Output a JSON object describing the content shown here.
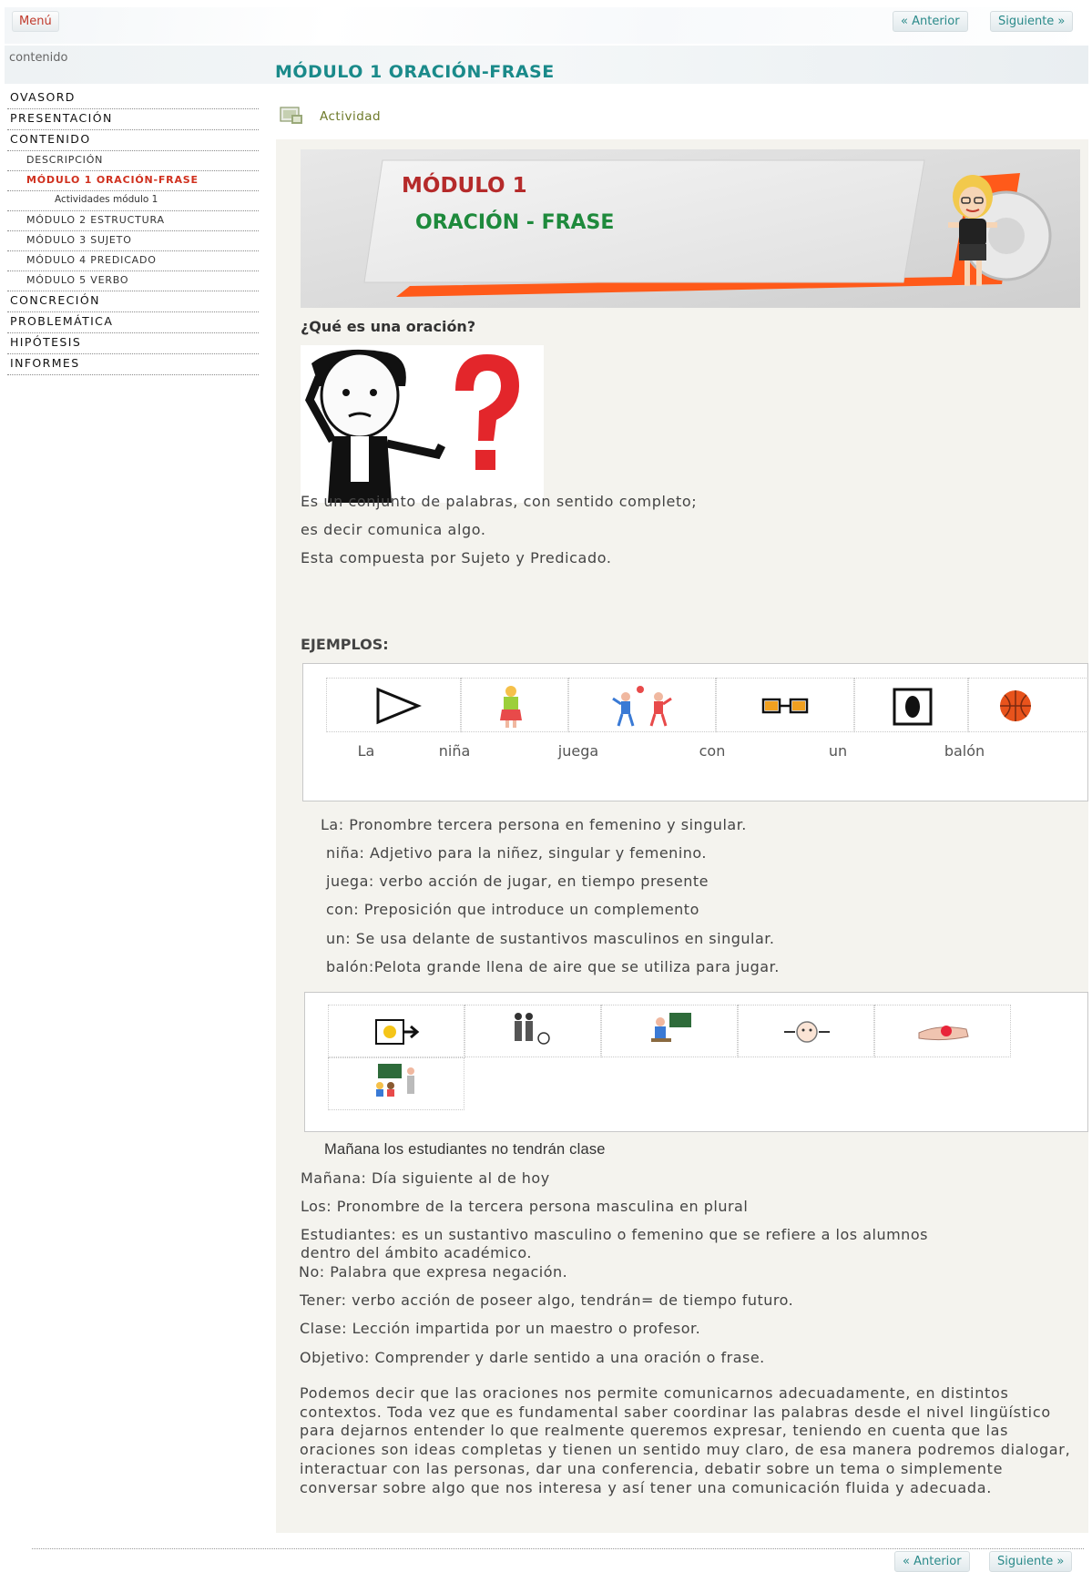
{
  "topbar": {
    "menu_label": "Menú",
    "prev_label": "« Anterior",
    "next_label": "Siguiente »"
  },
  "header": {
    "left_label": "contenido",
    "title": "MÓDULO 1 ORACIÓN-FRASE"
  },
  "sidebar": {
    "items": [
      {
        "label": "OVASORD",
        "level": 1
      },
      {
        "label": "PRESENTACIÓN",
        "level": 1
      },
      {
        "label": "CONTENIDO",
        "level": 1
      },
      {
        "label": "DESCRIPCIÓN",
        "level": 2
      },
      {
        "label": "MÓDULO 1 ORACIÓN-FRASE",
        "level": 2,
        "active": true
      },
      {
        "label": "Actividades módulo 1",
        "level": 3
      },
      {
        "label": "MÓDULO 2 ESTRUCTURA",
        "level": 2
      },
      {
        "label": "MÓDULO 3 SUJETO",
        "level": 2
      },
      {
        "label": "MÓDULO 4 PREDICADO",
        "level": 2
      },
      {
        "label": "MÓDULO 5 VERBO",
        "level": 2
      },
      {
        "label": "CONCRECIÓN",
        "level": 1
      },
      {
        "label": "PROBLEMÁTICA",
        "level": 1
      },
      {
        "label": "HIPÓTESIS",
        "level": 1
      },
      {
        "label": "INFORMES",
        "level": 1
      }
    ]
  },
  "activity": {
    "label": "Actividad"
  },
  "banner": {
    "line1": "MÓDULO 1",
    "line2": "ORACIÓN - FRASE"
  },
  "question": "¿Qué es una oración?",
  "definition": [
    "Es un conjunto de palabras, con sentido completo;",
    "es decir comunica algo.",
    "Esta compuesta por Sujeto y Predicado."
  ],
  "examples_title": "EJEMPLOS:",
  "example1": {
    "words": [
      "La",
      "niña",
      "juega",
      "con",
      "un",
      "balón"
    ],
    "icons": [
      "triangle-arrow-icon",
      "girl-icon",
      "playing-kids-icon",
      "link-icon",
      "oval-frame-icon",
      "basketball-icon"
    ],
    "notes": [
      "La: Pronombre tercera persona en femenino y singular.",
      "niña: Adjetivo para la niñez, singular y femenino.",
      "juega: verbo acción de jugar, en tiempo presente",
      "con: Preposición que introduce un complemento",
      "un: Se usa delante de sustantivos masculinos en singular.",
      "balón:Pelota grande llena de aire que se utiliza para jugar."
    ]
  },
  "example2": {
    "icons": [
      "tomorrow-sun-icon",
      "students-icon",
      "teacher-board-icon",
      "no-face-icon",
      "hand-have-icon",
      "class-icon"
    ],
    "sentence": "Mañana los estudiantes no tendrán clase",
    "notes": [
      "Mañana: Día siguiente al de hoy",
      "Los: Pronombre de la tercera persona masculina en plural",
      "Estudiantes: es un sustantivo masculino o femenino que se refiere a los alumnos",
      "dentro del ámbito académico.",
      "No: Palabra que expresa negación.",
      "Tener: verbo acción de poseer algo, tendrán= de tiempo futuro.",
      "Clase:  Lección impartida por un maestro o profesor.",
      "Objetivo: Comprender y darle sentido a una oración o frase."
    ]
  },
  "closing_paragraph": "Podemos decir que las oraciones nos permite comunicarnos adecuadamente, en distintos contextos. Toda vez que es fundamental saber coordinar las palabras desde el nivel lingüístico para dejarnos entender lo que realmente queremos expresar, teniendo en cuenta que las oraciones son ideas completas y tienen un sentido muy claro, de esa manera podremos dialogar, interactuar con las personas, dar una conferencia, debatir sobre un tema o simplemente conversar sobre algo que nos interesa  y así tener una comunicación fluida y adecuada.",
  "colors": {
    "accent_teal": "#1a8a8a",
    "active_red": "#d0301e",
    "banner_orange": "#ff5a1a",
    "banner_title": "#b52a2a",
    "banner_subtitle": "#1e8a3c"
  }
}
